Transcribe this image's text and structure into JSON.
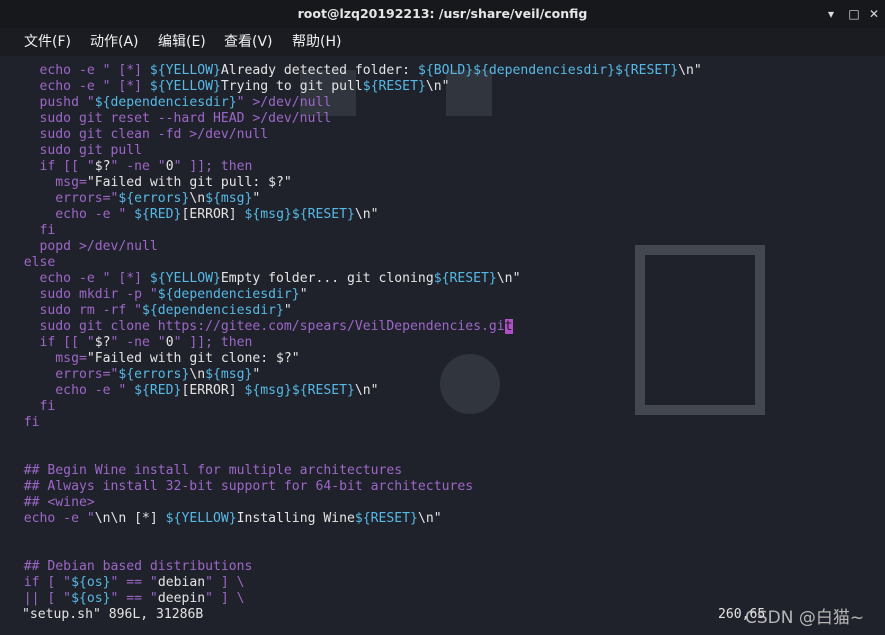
{
  "window": {
    "title": "root@lzq20192213: /usr/share/veil/config",
    "controls": {
      "minimize": "▾",
      "maximize": "□",
      "close": "✕"
    }
  },
  "menu": [
    "文件(F)",
    "动作(A)",
    "编辑(E)",
    "查看(V)",
    "帮助(H)"
  ],
  "code_lines": [
    [
      [
        "    echo -e \" [*] ",
        "tk-cmd"
      ],
      [
        "${YELLOW}",
        "tk-var"
      ],
      [
        "Already detected folder: ",
        "tk-txt"
      ],
      [
        "${BOLD}${dependenciesdir}${RESET}",
        "tk-var"
      ],
      [
        "\\n\"",
        "tk-txt"
      ]
    ],
    [
      [
        "    echo -e \" [*] ",
        "tk-cmd"
      ],
      [
        "${YELLOW}",
        "tk-var"
      ],
      [
        "Trying to git pull",
        "tk-txt"
      ],
      [
        "${RESET}",
        "tk-var"
      ],
      [
        "\\n\"",
        "tk-txt"
      ]
    ],
    [
      [
        "    pushd \"",
        "tk-cmd"
      ],
      [
        "${dependenciesdir}",
        "tk-var"
      ],
      [
        "\" >/dev/null",
        "tk-cmd"
      ]
    ],
    [
      [
        "    sudo git reset --hard HEAD >/dev/null",
        "tk-cmd"
      ]
    ],
    [
      [
        "    sudo git clean -fd >/dev/null",
        "tk-cmd"
      ]
    ],
    [
      [
        "    sudo git pull",
        "tk-cmd"
      ]
    ],
    [
      [
        "    if [[ \"",
        "tk-kw"
      ],
      [
        "$?",
        "tk-txt"
      ],
      [
        "\" -ne \"",
        "tk-kw"
      ],
      [
        "0",
        "tk-txt"
      ],
      [
        "\" ]]; then",
        "tk-kw"
      ]
    ],
    [
      [
        "      msg=",
        "tk-cmd"
      ],
      [
        "\"Failed with git pull: $?\"",
        "tk-txt"
      ]
    ],
    [
      [
        "      errors=\"",
        "tk-cmd"
      ],
      [
        "${errors}",
        "tk-var"
      ],
      [
        "\\n",
        "tk-txt"
      ],
      [
        "${msg}",
        "tk-var"
      ],
      [
        "\"",
        "tk-txt"
      ]
    ],
    [
      [
        "      echo -e \" ",
        "tk-cmd"
      ],
      [
        "${RED}",
        "tk-var"
      ],
      [
        "[ERROR] ",
        "tk-txt"
      ],
      [
        "${msg}${RESET}",
        "tk-var"
      ],
      [
        "\\n\"",
        "tk-txt"
      ]
    ],
    [
      [
        "    fi",
        "tk-kw"
      ]
    ],
    [
      [
        "    popd >/dev/null",
        "tk-cmd"
      ]
    ],
    [
      [
        "  else",
        "tk-kw"
      ]
    ],
    [
      [
        "    echo -e \" [*] ",
        "tk-cmd"
      ],
      [
        "${YELLOW}",
        "tk-var"
      ],
      [
        "Empty folder... git cloning",
        "tk-txt"
      ],
      [
        "${RESET}",
        "tk-var"
      ],
      [
        "\\n\"",
        "tk-txt"
      ]
    ],
    [
      [
        "    sudo mkdir -p \"",
        "tk-cmd"
      ],
      [
        "${dependenciesdir}",
        "tk-var"
      ],
      [
        "\"",
        "tk-txt"
      ]
    ],
    [
      [
        "    sudo rm -rf \"",
        "tk-cmd"
      ],
      [
        "${dependenciesdir}",
        "tk-var"
      ],
      [
        "\"",
        "tk-txt"
      ]
    ],
    [
      [
        "    sudo git clone https://gitee.com/spears/VeilDependencies.gi",
        "tk-cmd"
      ],
      [
        "t",
        "cursor"
      ]
    ],
    [
      [
        "    if [[ \"",
        "tk-kw"
      ],
      [
        "$?",
        "tk-txt"
      ],
      [
        "\" -ne \"",
        "tk-kw"
      ],
      [
        "0",
        "tk-txt"
      ],
      [
        "\" ]]; then",
        "tk-kw"
      ]
    ],
    [
      [
        "      msg=",
        "tk-cmd"
      ],
      [
        "\"Failed with git clone: $?\"",
        "tk-txt"
      ]
    ],
    [
      [
        "      errors=\"",
        "tk-cmd"
      ],
      [
        "${errors}",
        "tk-var"
      ],
      [
        "\\n",
        "tk-txt"
      ],
      [
        "${msg}",
        "tk-var"
      ],
      [
        "\"",
        "tk-txt"
      ]
    ],
    [
      [
        "      echo -e \" ",
        "tk-cmd"
      ],
      [
        "${RED}",
        "tk-var"
      ],
      [
        "[ERROR] ",
        "tk-txt"
      ],
      [
        "${msg}${RESET}",
        "tk-var"
      ],
      [
        "\\n\"",
        "tk-txt"
      ]
    ],
    [
      [
        "    fi",
        "tk-kw"
      ]
    ],
    [
      [
        "  fi",
        "tk-kw"
      ]
    ],
    [
      [
        "",
        "tk-txt"
      ]
    ],
    [
      [
        "",
        "tk-txt"
      ]
    ],
    [
      [
        "  ## Begin Wine install for multiple architectures",
        "tk-cm"
      ]
    ],
    [
      [
        "  ## Always install 32-bit support for 64-bit architectures",
        "tk-cm"
      ]
    ],
    [
      [
        "  ## <wine>",
        "tk-cm"
      ]
    ],
    [
      [
        "  echo -e \"",
        "tk-cmd"
      ],
      [
        "\\n\\n [*] ",
        "tk-txt"
      ],
      [
        "${YELLOW}",
        "tk-var"
      ],
      [
        "Installing Wine",
        "tk-txt"
      ],
      [
        "${RESET}",
        "tk-var"
      ],
      [
        "\\n\"",
        "tk-txt"
      ]
    ],
    [
      [
        "",
        "tk-txt"
      ]
    ],
    [
      [
        "",
        "tk-txt"
      ]
    ],
    [
      [
        "  ## Debian based distributions",
        "tk-cm"
      ]
    ],
    [
      [
        "  if [ \"",
        "tk-kw"
      ],
      [
        "${os}",
        "tk-var"
      ],
      [
        "\" == \"",
        "tk-kw"
      ],
      [
        "debian",
        "tk-txt"
      ],
      [
        "\" ] \\",
        "tk-kw"
      ]
    ],
    [
      [
        "  || [ \"",
        "tk-kw"
      ],
      [
        "${os}",
        "tk-var"
      ],
      [
        "\" == \"",
        "tk-kw"
      ],
      [
        "deepin",
        "tk-txt"
      ],
      [
        "\" ] \\",
        "tk-kw"
      ]
    ]
  ],
  "status": {
    "file": "\"setup.sh\" 896L, 31286B",
    "position": "260,65"
  },
  "watermark": "CSDN @白猫~",
  "colors": {
    "variable": "#56b9e6",
    "keyword": "#9d67c8",
    "text": "#e4e4e4",
    "cursor": "#b04fc8"
  }
}
